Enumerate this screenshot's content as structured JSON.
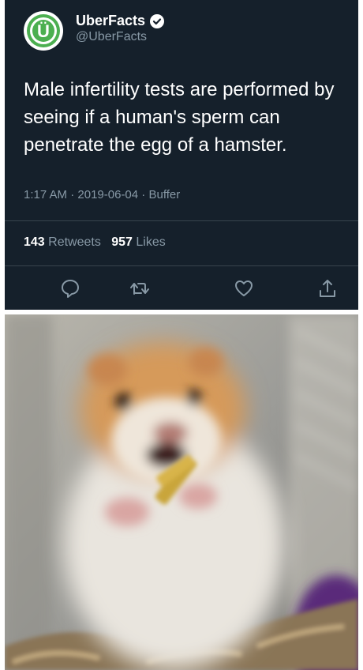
{
  "tweet": {
    "display_name": "UberFacts",
    "handle": "@UberFacts",
    "avatar_letter": "Ü",
    "text": "Male infertility tests are performed by seeing if a human's sperm can penetrate the egg of a hamster.",
    "time": "1:17 AM",
    "date": "2019-06-04",
    "source": "Buffer",
    "retweets_count": "143",
    "retweets_label": "Retweets",
    "likes_count": "957",
    "likes_label": "Likes"
  },
  "actions": {
    "icons": [
      "reply-icon",
      "retweet-icon",
      "like-icon",
      "share-icon"
    ]
  },
  "colors": {
    "background": "#15202b",
    "text_secondary": "#8899a6",
    "divider": "#38444d",
    "avatar_green": "#4caf50"
  }
}
